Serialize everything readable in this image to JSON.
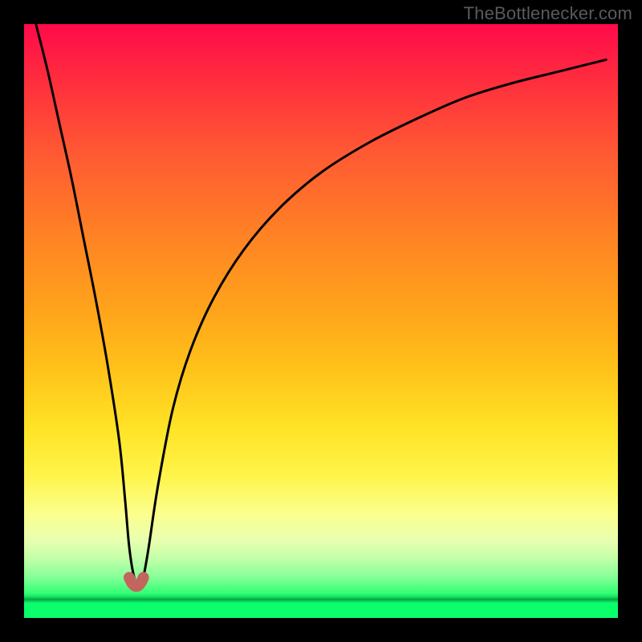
{
  "watermark": {
    "text": "TheBottlenecker.com"
  },
  "chart_data": {
    "type": "line",
    "title": "",
    "xlabel": "",
    "ylabel": "",
    "xlim": [
      0,
      100
    ],
    "ylim": [
      0,
      100
    ],
    "background_gradient": {
      "stops": [
        {
          "pos": 0.0,
          "color": "#ff0a4a"
        },
        {
          "pos": 0.22,
          "color": "#ff5a33"
        },
        {
          "pos": 0.48,
          "color": "#ffa31b"
        },
        {
          "pos": 0.68,
          "color": "#ffe326"
        },
        {
          "pos": 0.87,
          "color": "#e8ffb0"
        },
        {
          "pos": 0.968,
          "color": "#0aff6b"
        },
        {
          "pos": 1.0,
          "color": "#0aff6b"
        }
      ]
    },
    "series": [
      {
        "name": "bottleneck-curve",
        "color": "#000000",
        "x": [
          2,
          4,
          6,
          8,
          10,
          12,
          14,
          16,
          17,
          17.7,
          18.5,
          19.3,
          20.1,
          21,
          22.5,
          25,
          28,
          32,
          37,
          43,
          50,
          58,
          66,
          74,
          82,
          90,
          98
        ],
        "y": [
          100,
          92,
          83,
          74,
          64,
          54,
          43,
          30,
          20,
          12,
          7,
          5.5,
          7,
          12,
          22,
          35,
          45,
          54,
          62,
          69,
          75,
          80,
          84,
          87.5,
          90,
          92,
          94
        ]
      }
    ],
    "markers": [
      {
        "name": "notch-left-dot",
        "x": 17.7,
        "y": 6.8,
        "r": 6,
        "color": "#c3655f"
      },
      {
        "name": "notch-right-dot",
        "x": 20.1,
        "y": 6.8,
        "r": 6,
        "color": "#c3655f"
      },
      {
        "name": "notch-center-blob",
        "x": 18.9,
        "y": 5.2,
        "r": 8,
        "color": "#c3655f"
      }
    ]
  }
}
